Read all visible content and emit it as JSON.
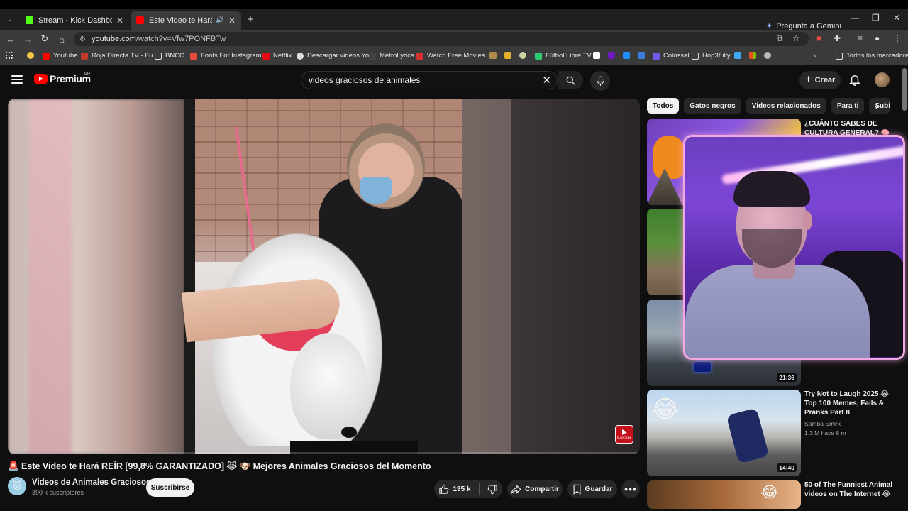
{
  "browser": {
    "tabs": [
      {
        "title": "Stream - Kick Dashboard",
        "favicon_color": "#53fc18",
        "active": false
      },
      {
        "title": "Este Video te Hará REÍR",
        "favicon_color": "#ff0000",
        "active": true
      }
    ],
    "gemini_label": "Pregunta a Gemini",
    "url_host": "youtube.com",
    "url_path": "/watch?v=Vfw7PONFBTw",
    "bookmarks": [
      {
        "label": "",
        "color": "#f6c744"
      },
      {
        "label": "Youtube",
        "color": "#ff0000"
      },
      {
        "label": "Roja Directa TV - Fu...",
        "color": "#c0392b"
      },
      {
        "label": "BNCO",
        "color": "#888888"
      },
      {
        "label": "Fonts For Instagram...",
        "color": "#e74c3c"
      },
      {
        "label": "Netflix",
        "color": "#e50914"
      },
      {
        "label": "Descargar videos Yo...",
        "color": "#dddddd"
      },
      {
        "label": "MetroLyrics",
        "color": "#222222"
      },
      {
        "label": "Watch Free Movies...",
        "color": "#d63031"
      },
      {
        "label": "Fútbol Libre TV",
        "color": "#2ecc71"
      },
      {
        "label": "Colossal",
        "color": "#6c5ce7"
      },
      {
        "label": "Hop3fully",
        "color": "#999999"
      }
    ],
    "all_bookmarks_label": "Todos los marcadores"
  },
  "youtube": {
    "logo_text": "Premium",
    "country_code": "AR",
    "search_value": "videos graciosos de animales",
    "create_label": "Crear",
    "video": {
      "title": "🚨 Este Video te Hará REÍR [99,8% GARANTIZADO] 😹 🐶 Mejores Animales Graciosos del Momento",
      "watermark_label": "SUBSCRIBE",
      "channel_name": "Videos de Animales Graciosos",
      "subscribers": "390 k suscriptores",
      "subscribe_label": "Suscribirse",
      "likes": "195 k",
      "share_label": "Compartir",
      "save_label": "Guardar"
    },
    "chips": [
      "Todos",
      "Gatos negros",
      "Videos relacionados",
      "Para ti",
      "Subidos"
    ],
    "related": [
      {
        "title": "¿CUÁNTO SABES DE CULTURA GENERAL? 🧠 😁",
        "channel": "",
        "meta": "",
        "duration": ""
      },
      {
        "title": "",
        "channel": "",
        "meta": "",
        "duration": ""
      },
      {
        "title": "",
        "channel": "",
        "meta": "",
        "duration": "21:36"
      },
      {
        "title": "Try Not to Laugh 2025 😂 Top 100 Memes, Fails & Pranks Part 8",
        "channel": "Samba Smirk",
        "meta": "1.3 M  hace 8 m",
        "duration": "14:40"
      },
      {
        "title": "50 of The Funniest Animal videos on The Internet 😂",
        "channel": "",
        "meta": "",
        "duration": ""
      }
    ]
  }
}
